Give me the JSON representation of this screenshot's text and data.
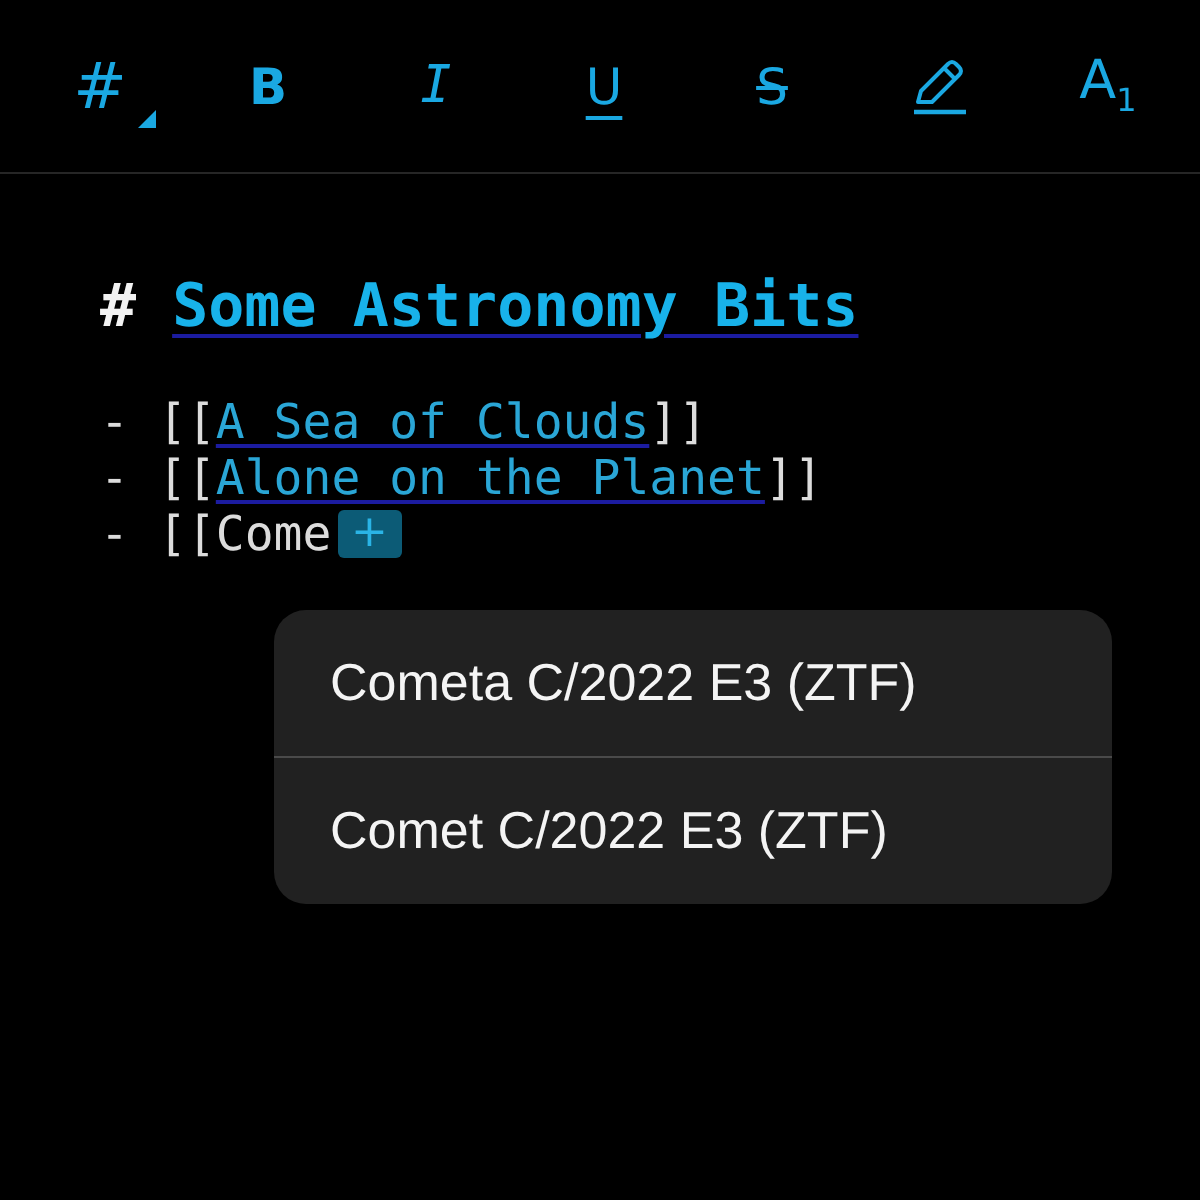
{
  "toolbar": {
    "items": [
      {
        "kind": "heading",
        "label": "#",
        "has_menu": true
      },
      {
        "kind": "bold",
        "label": "B",
        "has_menu": false
      },
      {
        "kind": "italic",
        "label": "I",
        "has_menu": false
      },
      {
        "kind": "underline",
        "label": "U",
        "has_menu": false
      },
      {
        "kind": "strike",
        "label": "S",
        "has_menu": false
      },
      {
        "kind": "highlight",
        "has_menu": false
      },
      {
        "kind": "style",
        "label": "A$_{1}$",
        "has_menu": false
      }
    ]
  },
  "editor": {
    "heading": {
      "marker": "#",
      "text": "Some Astronomy Bits"
    },
    "lines": [
      {
        "bullet": "-",
        "open": "[[",
        "link": "A Sea of Clouds",
        "close": "]]"
      },
      {
        "bullet": "-",
        "open": "[[",
        "link": "Alone on the Planet",
        "close": "]]"
      },
      {
        "bullet": "-",
        "open": "[[",
        "typed": "Come"
      }
    ],
    "insert_button": {
      "label": "+"
    }
  },
  "suggestions": [
    {
      "label": "Cometa C/2022 E3 (ZTF)"
    },
    {
      "label": "Comet C/2022 E3 (ZTF)"
    }
  ]
}
